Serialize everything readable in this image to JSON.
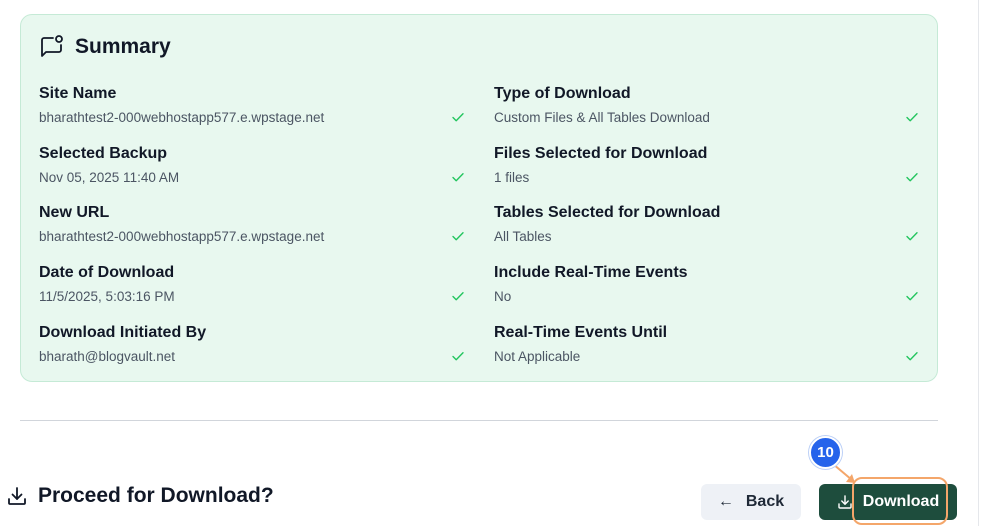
{
  "summary": {
    "title": "Summary",
    "fields": [
      {
        "label": "Site Name",
        "value": "bharathtest2-000webhostapp577.e.wpstage.net"
      },
      {
        "label": "Type of Download",
        "value": "Custom Files & All Tables Download"
      },
      {
        "label": "Selected Backup",
        "value": "Nov 05, 2025 11:40 AM"
      },
      {
        "label": "Files Selected for Download",
        "value": "1 files"
      },
      {
        "label": "New URL",
        "value": "bharathtest2-000webhostapp577.e.wpstage.net"
      },
      {
        "label": "Tables Selected for Download",
        "value": "All Tables"
      },
      {
        "label": "Date of Download",
        "value": "11/5/2025, 5:03:16 PM"
      },
      {
        "label": "Include Real-Time Events",
        "value": "No"
      },
      {
        "label": "Download Initiated By",
        "value": "bharath@blogvault.net"
      },
      {
        "label": "Real-Time Events Until",
        "value": "Not Applicable"
      }
    ]
  },
  "footer": {
    "proceed_text": "Proceed for Download?",
    "back_label": "Back",
    "download_label": "Download",
    "step_badge": "10"
  },
  "icons": {
    "summary": "message-square-icon",
    "proceed": "download-icon",
    "back": "arrow-left-icon",
    "download_button": "download-icon",
    "field_status": "check-icon"
  },
  "colors": {
    "card_bg": "#e8f8ef",
    "card_border": "#c5ead6",
    "check": "#22c55e",
    "download_bg": "#1e4d3d",
    "back_bg": "#eef1f6",
    "badge": "#2563eb",
    "highlight": "#f4a66a"
  }
}
